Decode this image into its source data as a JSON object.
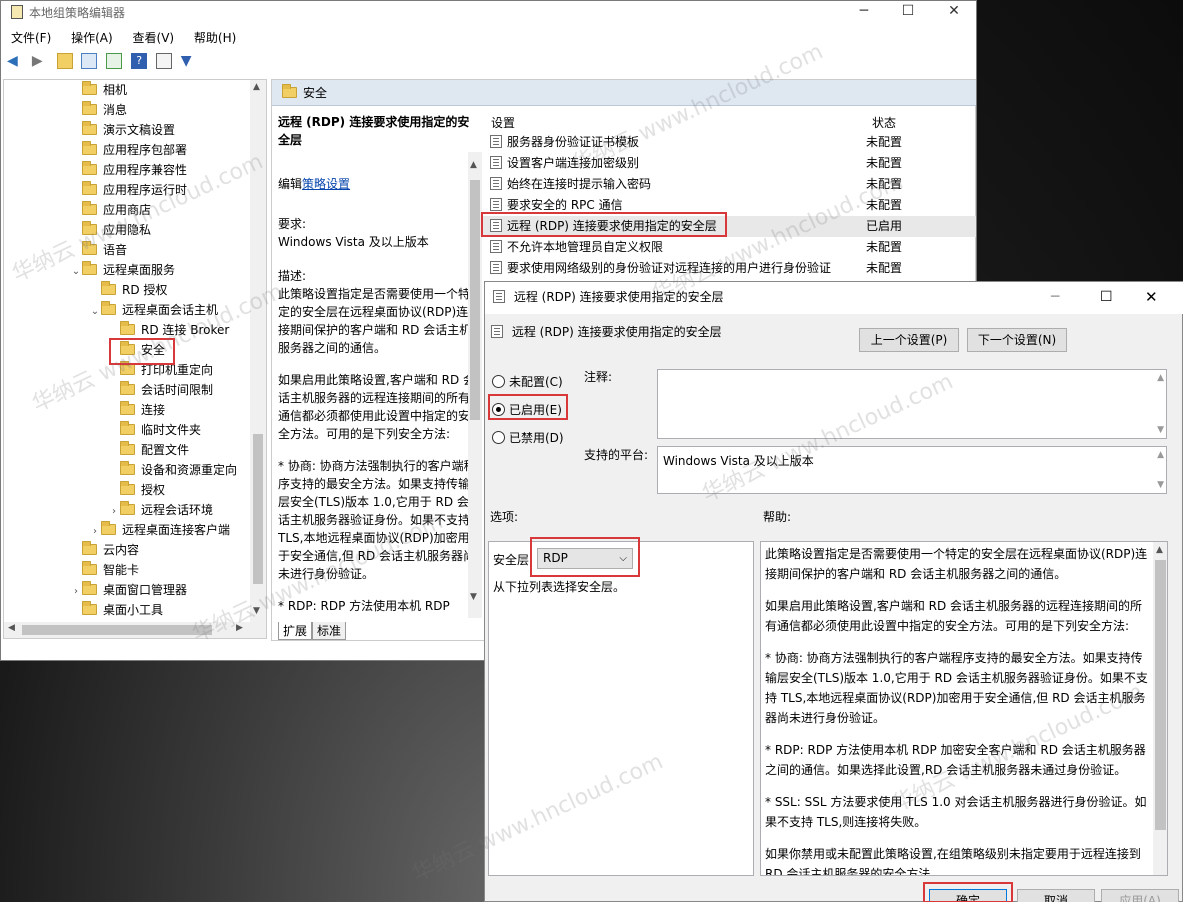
{
  "main_window": {
    "title": "本地组策略编辑器",
    "menu": [
      "文件(F)",
      "操作(A)",
      "查看(V)",
      "帮助(H)"
    ]
  },
  "tree": {
    "items": [
      {
        "label": "相机",
        "level": 0
      },
      {
        "label": "消息",
        "level": 0
      },
      {
        "label": "演示文稿设置",
        "level": 0
      },
      {
        "label": "应用程序包部署",
        "level": 0
      },
      {
        "label": "应用程序兼容性",
        "level": 0
      },
      {
        "label": "应用程序运行时",
        "level": 0
      },
      {
        "label": "应用商店",
        "level": 0
      },
      {
        "label": "应用隐私",
        "level": 0
      },
      {
        "label": "语音",
        "level": 0
      },
      {
        "label": "远程桌面服务",
        "level": 0
      },
      {
        "label": "RD 授权",
        "level": 1
      },
      {
        "label": "远程桌面会话主机",
        "level": 1
      },
      {
        "label": "RD 连接 Broker",
        "level": 2
      },
      {
        "label": "安全",
        "level": 2
      },
      {
        "label": "打印机重定向",
        "level": 2
      },
      {
        "label": "会话时间限制",
        "level": 2
      },
      {
        "label": "连接",
        "level": 2
      },
      {
        "label": "临时文件夹",
        "level": 2
      },
      {
        "label": "配置文件",
        "level": 2
      },
      {
        "label": "设备和资源重定向",
        "level": 2
      },
      {
        "label": "授权",
        "level": 2
      },
      {
        "label": "远程会话环境",
        "level": 2
      },
      {
        "label": "远程桌面连接客户端",
        "level": 1
      },
      {
        "label": "云内容",
        "level": 0
      },
      {
        "label": "智能卡",
        "level": 0
      },
      {
        "label": "桌面窗口管理器",
        "level": 0
      },
      {
        "label": "桌面小工具",
        "level": 0
      }
    ]
  },
  "content": {
    "folder_title": "安全",
    "policy_heading": "远程 (RDP) 连接要求使用指定的安全层",
    "edit_prefix": "编辑",
    "edit_link": "策略设置",
    "requirements_label": "要求:",
    "requirements_value": "Windows Vista 及以上版本",
    "description_label": "描述:",
    "description_paragraphs": [
      "此策略设置指定是否需要使用一个特定的安全层在远程桌面协议(RDP)连接期间保护的客户端和 RD 会话主机服务器之间的通信。",
      "如果启用此策略设置,客户端和 RD 会话主机服务器的远程连接期间的所有通信都必须都使用此设置中指定的安全方法。可用的是下列安全方法:",
      "* 协商: 协商方法强制执行的客户端程序支持的最安全方法。如果支持传输层安全(TLS)版本 1.0,它用于 RD 会话主机服务器验证身份。如果不支持 TLS,本地远程桌面协议(RDP)加密用于安全通信,但 RD 会话主机服务器尚未进行身份验证。",
      "* RDP: RDP 方法使用本机 RDP"
    ],
    "tabs": [
      "扩展",
      "标准"
    ]
  },
  "settings_list": {
    "col_setting": "设置",
    "col_state": "状态",
    "rows": [
      {
        "name": "服务器身份验证证书模板",
        "state": "未配置"
      },
      {
        "name": "设置客户端连接加密级别",
        "state": "未配置"
      },
      {
        "name": "始终在连接时提示输入密码",
        "state": "未配置"
      },
      {
        "name": "要求安全的 RPC 通信",
        "state": "未配置"
      },
      {
        "name": "远程 (RDP) 连接要求使用指定的安全层",
        "state": "已启用"
      },
      {
        "name": "不允许本地管理员自定义权限",
        "state": "未配置"
      },
      {
        "name": "要求使用网络级别的身份验证对远程连接的用户进行身份验证",
        "state": "未配置"
      }
    ]
  },
  "dialog": {
    "title": "远程 (RDP) 连接要求使用指定的安全层",
    "header_name": "远程 (RDP) 连接要求使用指定的安全层",
    "prev_button": "上一个设置(P)",
    "next_button": "下一个设置(N)",
    "radio_not_configured": "未配置(C)",
    "radio_enabled": "已启用(E)",
    "radio_disabled": "已禁用(D)",
    "comment_label": "注释:",
    "platform_label": "支持的平台:",
    "platform_value": "Windows Vista 及以上版本",
    "options_label": "选项:",
    "help_label": "帮助:",
    "security_layer_label": "安全层",
    "security_layer_value": "RDP",
    "security_layer_hint": "从下拉列表选择安全层。",
    "help_paragraphs": [
      "此策略设置指定是否需要使用一个特定的安全层在远程桌面协议(RDP)连接期间保护的客户端和 RD 会话主机服务器之间的通信。",
      "如果启用此策略设置,客户端和 RD 会话主机服务器的远程连接期间的所有通信都必须使用此设置中指定的安全方法。可用的是下列安全方法:",
      "* 协商: 协商方法强制执行的客户端程序支持的最安全方法。如果支持传输层安全(TLS)版本 1.0,它用于 RD 会话主机服务器验证身份。如果不支持 TLS,本地远程桌面协议(RDP)加密用于安全通信,但 RD 会话主机服务器尚未进行身份验证。",
      "* RDP: RDP 方法使用本机 RDP 加密安全客户端和 RD 会话主机服务器之间的通信。如果选择此设置,RD 会话主机服务器未通过身份验证。",
      "* SSL: SSL 方法要求使用 TLS 1.0 对会话主机服务器进行身份验证。如果不支持 TLS,则连接将失败。",
      "如果你禁用或未配置此策略设置,在组策略级别未指定要用于远程连接到 RD 会话主机服务器的安全方法。"
    ],
    "ok_button": "确定",
    "cancel_button": "取消",
    "apply_button": "应用(A)"
  },
  "watermark": "华纳云 www.hncloud.com"
}
